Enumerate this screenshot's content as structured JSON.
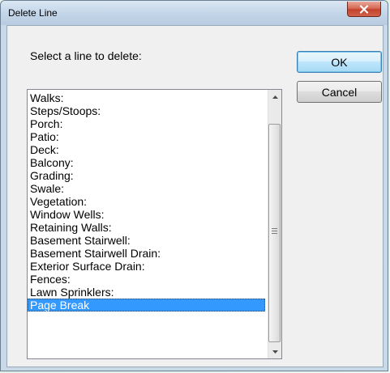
{
  "window": {
    "title": "Delete Line",
    "close_icon": "close-icon"
  },
  "dialog": {
    "prompt": "Select a line to delete:",
    "ok_label": "OK",
    "cancel_label": "Cancel"
  },
  "list": {
    "items": [
      "Walks:",
      "Steps/Stoops:",
      "Porch:",
      "Patio:",
      "Deck:",
      "Balcony:",
      "Grading:",
      "Swale:",
      "Vegetation:",
      "Window Wells:",
      "Retaining Walls:",
      "Basement Stairwell:",
      "Basement Stairwell Drain:",
      "Exterior Surface Drain:",
      "Fences:",
      "Lawn Sprinklers:",
      "Page Break"
    ],
    "selected_index": 16
  },
  "colors": {
    "selection": "#3399ff",
    "close_button": "#c3432c",
    "default_button_border": "#3c7fb1"
  }
}
